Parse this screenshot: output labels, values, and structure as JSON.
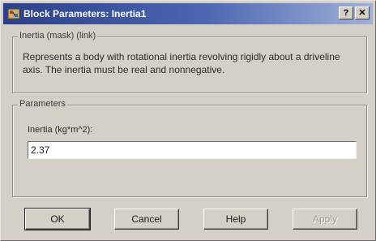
{
  "window": {
    "title": "Block Parameters: Inertia1",
    "help_glyph": "?",
    "close_glyph": "✕"
  },
  "description": {
    "legend": "Inertia (mask) (link)",
    "text": "Represents a body with rotational inertia revolving rigidly about a driveline axis. The inertia must be real and nonnegative."
  },
  "parameters": {
    "legend": "Parameters",
    "inertia_label": "Inertia (kg*m^2):",
    "inertia_value": "2.37"
  },
  "buttons": {
    "ok": "OK",
    "cancel": "Cancel",
    "help": "Help",
    "apply": "Apply"
  },
  "colors": {
    "titlebar_start": "#2a3f8a",
    "titlebar_end": "#9fb0d8",
    "face": "#d4d0c8"
  },
  "icons": {
    "app": "simulink-block-icon",
    "help": "question-mark-icon",
    "close": "close-icon"
  }
}
